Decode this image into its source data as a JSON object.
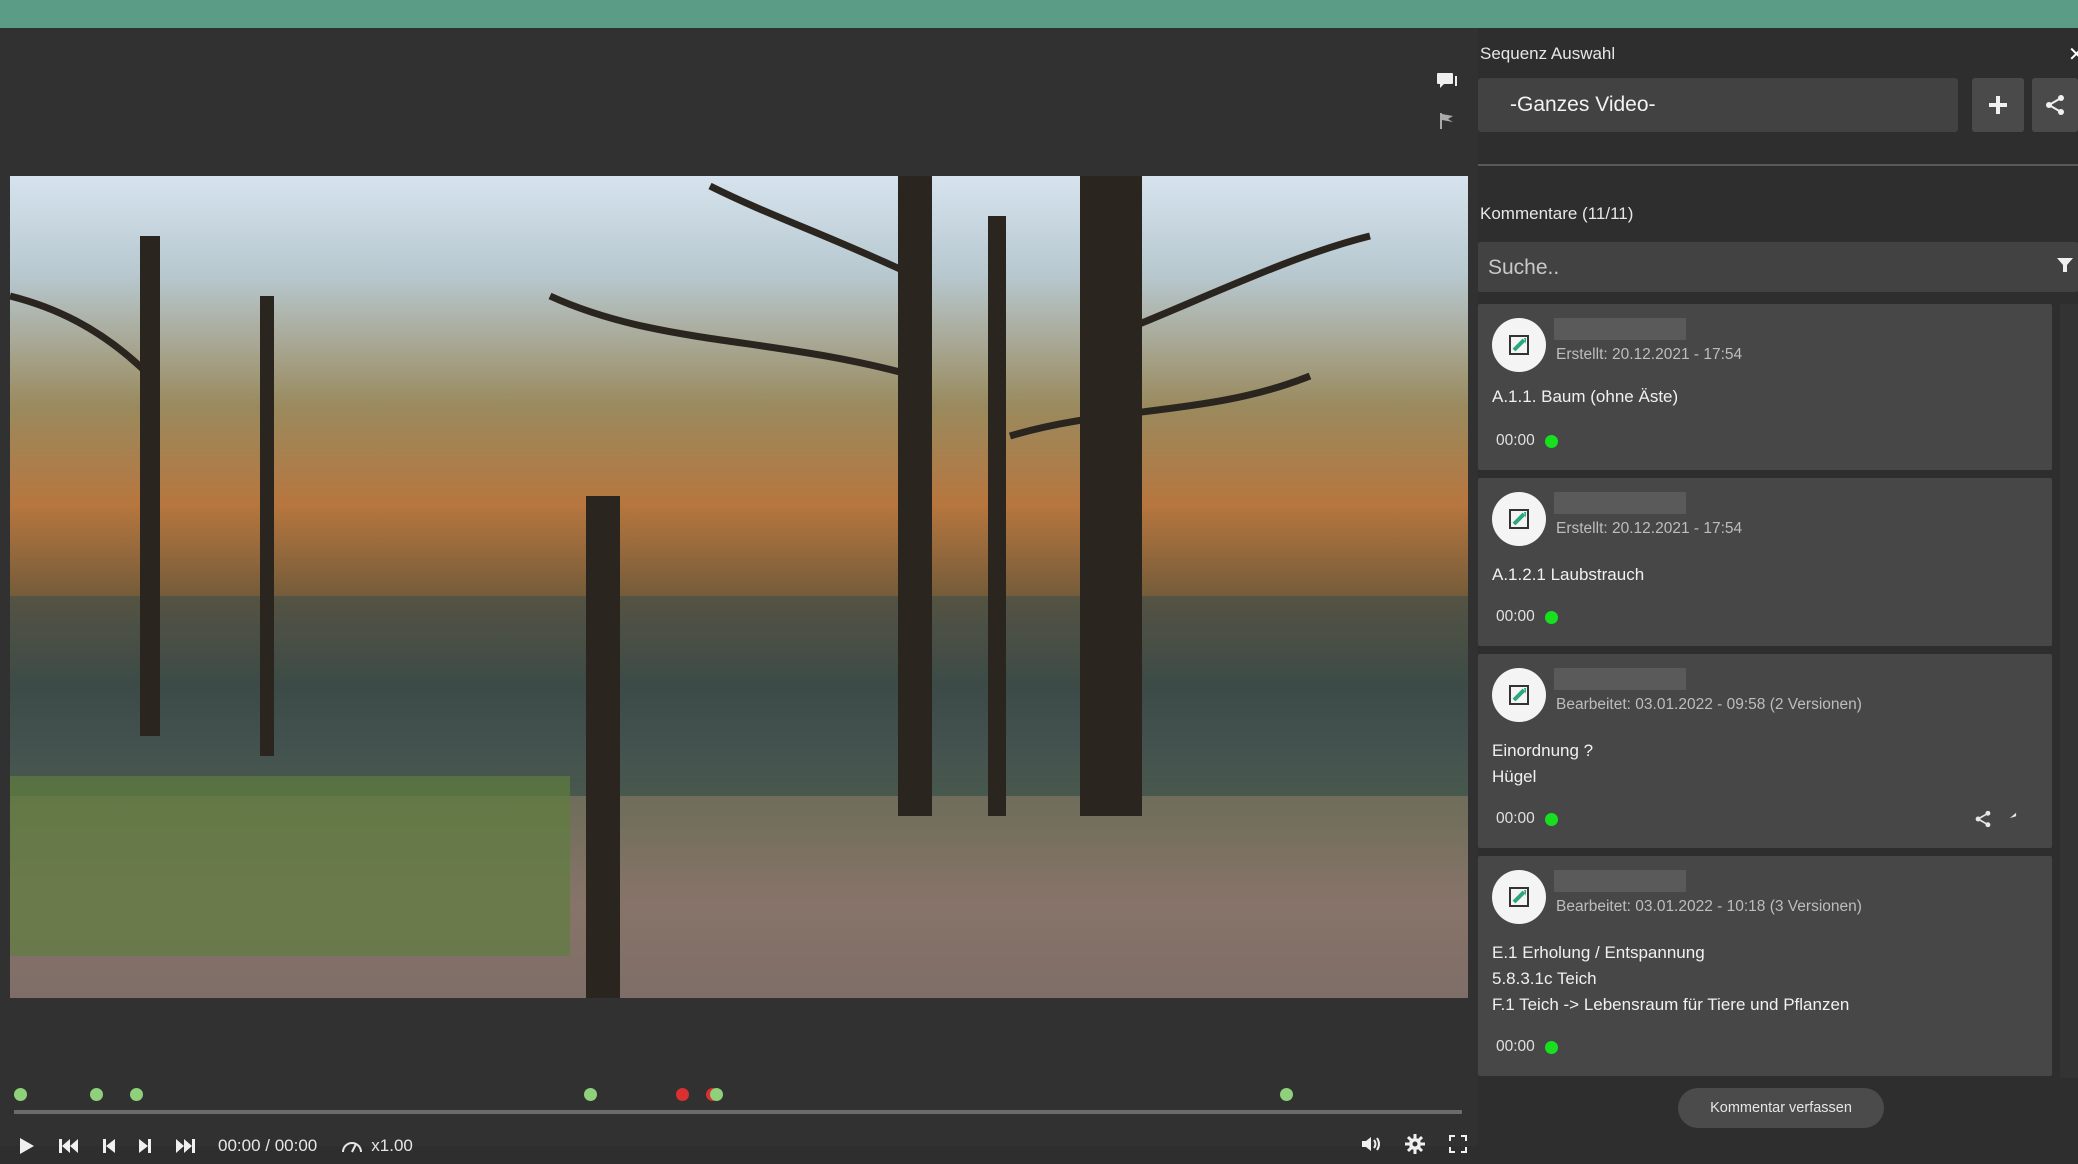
{
  "player": {
    "time": "00:00 / 00:00",
    "speed": "x1.00",
    "timeline_markers": [
      {
        "color": "#8fd07a"
      },
      {
        "color": "#8fd07a"
      },
      {
        "color": "#8fd07a"
      },
      {
        "color": "#8fd07a"
      },
      {
        "color": "#d93030"
      },
      {
        "color": "#d93030"
      },
      {
        "color": "#8fd07a"
      },
      {
        "color": "#8fd07a"
      }
    ]
  },
  "panel": {
    "sequence_title": "Sequenz Auswahl",
    "sequence_value": "-Ganzes Video-",
    "comments_title": "Kommentare (11/11)",
    "search_placeholder": "Suche..",
    "compose_label": "Kommentar verfassen",
    "comments": [
      {
        "meta": "Erstellt: 20.12.2021 - 17:54",
        "lines": [
          "A.1.1. Baum (ohne Äste)"
        ],
        "time": "00:00"
      },
      {
        "meta": "Erstellt: 20.12.2021 - 17:54",
        "lines": [
          "A.1.2.1 Laubstrauch"
        ],
        "time": "00:00"
      },
      {
        "meta": "Bearbeitet: 03.01.2022 - 09:58 (2 Versionen)",
        "lines": [
          "Einordnung ?",
          "Hügel"
        ],
        "time": "00:00"
      },
      {
        "meta": "Bearbeitet: 03.01.2022 - 10:18 (3 Versionen)",
        "lines": [
          "E.1 Erholung / Entspannung",
          "5.8.3.1c Teich",
          "F.1 Teich -> Lebensraum für Tiere und Pflanzen"
        ],
        "time": "00:00"
      }
    ]
  },
  "colors": {
    "accent": "#5a9c86",
    "status_dot": "#18e020"
  }
}
